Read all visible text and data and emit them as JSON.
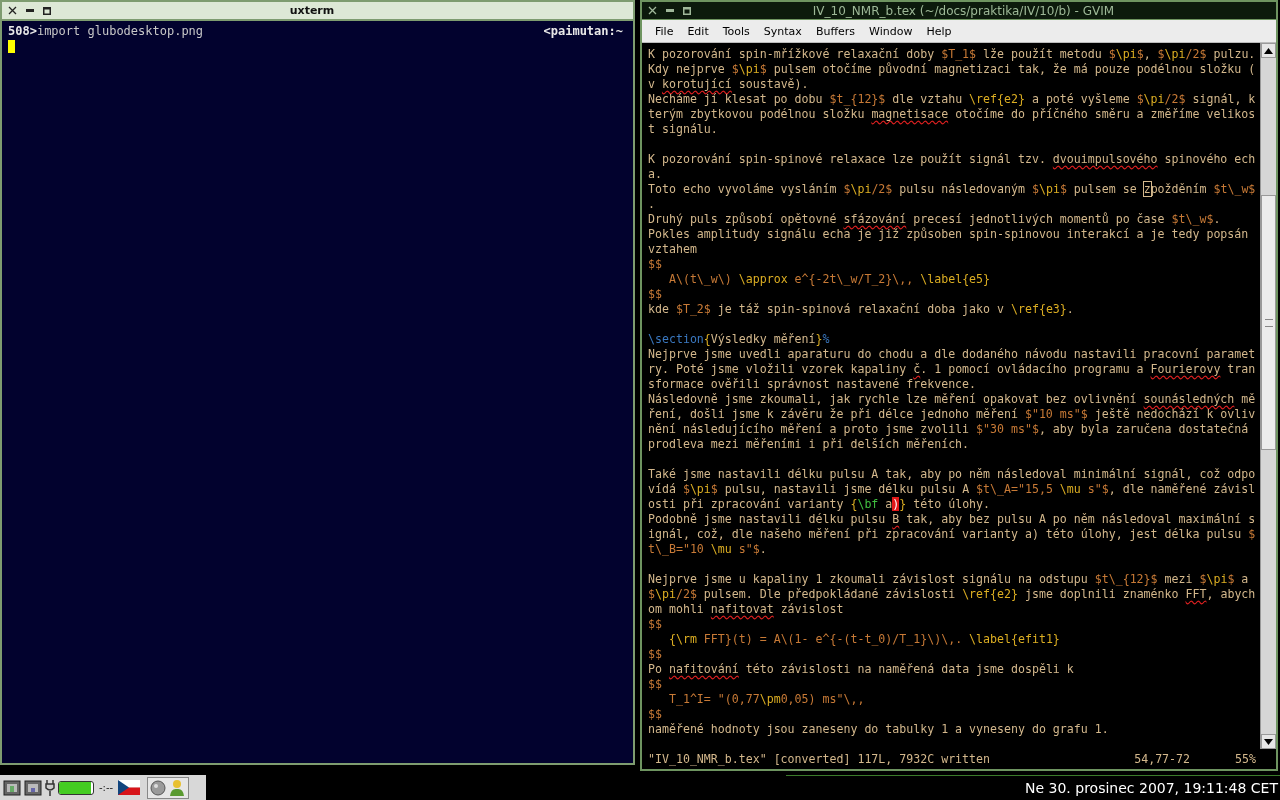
{
  "terminal": {
    "title": "uxterm",
    "prompt": "508>",
    "command": "import glubodesktop.png",
    "host": "<paimutan:~"
  },
  "editor": {
    "title": "IV_10_NMR_b.tex (~/docs/praktika/IV/10/b) - GVIM",
    "menu": [
      "File",
      "Edit",
      "Tools",
      "Syntax",
      "Buffers",
      "Window",
      "Help"
    ],
    "lines": [
      {
        "kind": "line",
        "segments": [
          {
            "kind": "text",
            "text": "K pozorování spin-mřížkové relaxační doby "
          },
          {
            "kind": "math",
            "text": "$T_1$"
          },
          {
            "kind": "text",
            "text": " lže použít metodu "
          },
          {
            "kind": "math",
            "text": "$"
          },
          {
            "kind": "command",
            "text": "\\pi"
          },
          {
            "kind": "math",
            "text": "$"
          },
          {
            "kind": "text",
            "text": ", "
          },
          {
            "kind": "math",
            "text": "$"
          },
          {
            "kind": "command",
            "text": "\\pi"
          },
          {
            "kind": "math",
            "text": "/2$"
          },
          {
            "kind": "text",
            "text": " pulzu."
          }
        ]
      },
      {
        "kind": "line",
        "segments": [
          {
            "kind": "text",
            "text": "Kdy nejprve "
          },
          {
            "kind": "math",
            "text": "$"
          },
          {
            "kind": "command",
            "text": "\\pi"
          },
          {
            "kind": "math",
            "text": "$"
          },
          {
            "kind": "text",
            "text": " pulsem otočíme původní magnetizaci tak, že má pouze podélnou složku ("
          }
        ]
      },
      {
        "kind": "line",
        "segments": [
          {
            "kind": "text",
            "text": "v "
          },
          {
            "kind": "spell",
            "text": "korotující"
          },
          {
            "kind": "text",
            "text": " soustavě)."
          }
        ]
      },
      {
        "kind": "line",
        "segments": [
          {
            "kind": "text",
            "text": "Necháme jí klesat po dobu "
          },
          {
            "kind": "math",
            "text": "$t_{12}$"
          },
          {
            "kind": "text",
            "text": " dle vztahu "
          },
          {
            "kind": "command",
            "text": "\\ref{e2}"
          },
          {
            "kind": "text",
            "text": " a poté vyšleme "
          },
          {
            "kind": "math",
            "text": "$"
          },
          {
            "kind": "command",
            "text": "\\pi"
          },
          {
            "kind": "math",
            "text": "/2$"
          },
          {
            "kind": "text",
            "text": " signál, k"
          }
        ]
      },
      {
        "kind": "line",
        "segments": [
          {
            "kind": "text",
            "text": "terým zbytkovou podélnou složku "
          },
          {
            "kind": "spell",
            "text": "magnetisace"
          },
          {
            "kind": "text",
            "text": " otočíme do příčného směru a změříme velikos"
          }
        ]
      },
      {
        "kind": "line",
        "segments": [
          {
            "kind": "text",
            "text": "t signálu."
          }
        ]
      },
      {
        "kind": "blank"
      },
      {
        "kind": "line",
        "segments": [
          {
            "kind": "text",
            "text": "K pozorování spin-spinové relaxace lze použít signál tzv. "
          },
          {
            "kind": "spell",
            "text": "dvouimpulsového"
          },
          {
            "kind": "text",
            "text": " spinového ech"
          }
        ]
      },
      {
        "kind": "line",
        "segments": [
          {
            "kind": "text",
            "text": "a."
          }
        ]
      },
      {
        "kind": "line",
        "segments": [
          {
            "kind": "text",
            "text": "Toto echo vyvoláme vysláním "
          },
          {
            "kind": "math",
            "text": "$"
          },
          {
            "kind": "command",
            "text": "\\pi"
          },
          {
            "kind": "math",
            "text": "/2$"
          },
          {
            "kind": "text",
            "text": " pulsu následovaným "
          },
          {
            "kind": "math",
            "text": "$"
          },
          {
            "kind": "command",
            "text": "\\pi"
          },
          {
            "kind": "math",
            "text": "$"
          },
          {
            "kind": "text",
            "text": " pulsem se "
          },
          {
            "kind": "cursor",
            "text": "z"
          },
          {
            "kind": "text",
            "text": "požděním "
          },
          {
            "kind": "math",
            "text": "$t\\_w$"
          }
        ]
      },
      {
        "kind": "line",
        "segments": [
          {
            "kind": "text",
            "text": "."
          }
        ]
      },
      {
        "kind": "line",
        "segments": [
          {
            "kind": "text",
            "text": "Druhý puls způsobí opětovné "
          },
          {
            "kind": "spell",
            "text": "sfázování"
          },
          {
            "kind": "text",
            "text": " precesí jednotlivých momentů po čase "
          },
          {
            "kind": "math",
            "text": "$t\\_w$"
          },
          {
            "kind": "text",
            "text": "."
          }
        ]
      },
      {
        "kind": "line",
        "segments": [
          {
            "kind": "text",
            "text": "Pokles amplitudy signálu echa je již způsoben spin-spinovou interakcí a je tedy popsán"
          }
        ]
      },
      {
        "kind": "line",
        "segments": [
          {
            "kind": "text",
            "text": "vztahem"
          }
        ]
      },
      {
        "kind": "line",
        "segments": [
          {
            "kind": "math",
            "text": "$$"
          }
        ]
      },
      {
        "kind": "line",
        "segments": [
          {
            "kind": "math",
            "text": "   A\\(t\\_w\\) "
          },
          {
            "kind": "command",
            "text": "\\approx"
          },
          {
            "kind": "math",
            "text": " e^{-2t\\_w/T_2}\\,, "
          },
          {
            "kind": "command",
            "text": "\\label{e5}"
          }
        ]
      },
      {
        "kind": "line",
        "segments": [
          {
            "kind": "math",
            "text": "$$"
          }
        ]
      },
      {
        "kind": "line",
        "segments": [
          {
            "kind": "text",
            "text": "kde "
          },
          {
            "kind": "math",
            "text": "$T_2$"
          },
          {
            "kind": "text",
            "text": " je táž spin-spinová relaxační doba jako v "
          },
          {
            "kind": "command",
            "text": "\\ref{e3}"
          },
          {
            "kind": "text",
            "text": "."
          }
        ]
      },
      {
        "kind": "blank"
      },
      {
        "kind": "line",
        "segments": [
          {
            "kind": "section",
            "text": "\\section"
          },
          {
            "kind": "command",
            "text": "{"
          },
          {
            "kind": "text",
            "text": "Výsledky měření"
          },
          {
            "kind": "command",
            "text": "}"
          },
          {
            "kind": "section",
            "text": "%"
          }
        ]
      },
      {
        "kind": "line",
        "segments": [
          {
            "kind": "text",
            "text": "Nejprve jsme uvedli aparaturu do chodu a dle dodaného návodu nastavili pracovní paramet"
          }
        ]
      },
      {
        "kind": "line",
        "segments": [
          {
            "kind": "text",
            "text": "ry. Poté jsme vložili vzorek kapaliny "
          },
          {
            "kind": "spell",
            "text": "č"
          },
          {
            "kind": "text",
            "text": ". 1 pomocí ovládacího programu a "
          },
          {
            "kind": "spell",
            "text": "Fourierovy"
          },
          {
            "kind": "text",
            "text": " tran"
          }
        ]
      },
      {
        "kind": "line",
        "segments": [
          {
            "kind": "text",
            "text": "sformace ověřili správnost nastavené frekvence."
          }
        ]
      },
      {
        "kind": "line",
        "segments": [
          {
            "kind": "text",
            "text": "Následovně jsme zkoumali, jak rychle lze měření opakovat bez ovlivnění "
          },
          {
            "kind": "spell",
            "text": "sounásledných"
          },
          {
            "kind": "text",
            "text": " mě"
          }
        ]
      },
      {
        "kind": "line",
        "segments": [
          {
            "kind": "text",
            "text": "ření, došli jsme k závěru že při délce jednoho měření "
          },
          {
            "kind": "math",
            "text": "$\"10 ms\"$"
          },
          {
            "kind": "text",
            "text": " ještě nedochází k ovliv"
          }
        ]
      },
      {
        "kind": "line",
        "segments": [
          {
            "kind": "text",
            "text": "nění následujícího měření a proto jsme zvolili "
          },
          {
            "kind": "math",
            "text": "$\"30 ms\"$"
          },
          {
            "kind": "text",
            "text": ", aby byla zaručena dostatečná"
          }
        ]
      },
      {
        "kind": "line",
        "segments": [
          {
            "kind": "text",
            "text": "prodleva mezi měřeními i při delších měřeních."
          }
        ]
      },
      {
        "kind": "blank"
      },
      {
        "kind": "line",
        "segments": [
          {
            "kind": "text",
            "text": "Také jsme nastavili délku pulsu A tak, aby po něm následoval minimální signál, což odpo"
          }
        ]
      },
      {
        "kind": "line",
        "segments": [
          {
            "kind": "text",
            "text": "vídá "
          },
          {
            "kind": "math",
            "text": "$"
          },
          {
            "kind": "command",
            "text": "\\pi"
          },
          {
            "kind": "math",
            "text": "$"
          },
          {
            "kind": "text",
            "text": " pulsu, nastavili jsme délku pulsu A "
          },
          {
            "kind": "math",
            "text": "$t\\_A=\"15,5 "
          },
          {
            "kind": "command",
            "text": "\\mu"
          },
          {
            "kind": "math",
            "text": " s\"$"
          },
          {
            "kind": "text",
            "text": ", dle naměřené závisl"
          }
        ]
      },
      {
        "kind": "line",
        "segments": [
          {
            "kind": "text",
            "text": "osti při zpracování varianty "
          },
          {
            "kind": "command",
            "text": "{"
          },
          {
            "kind": "bold",
            "text": "\\bf"
          },
          {
            "kind": "text",
            "text": " a"
          },
          {
            "kind": "error",
            "text": ")"
          },
          {
            "kind": "command",
            "text": "}"
          },
          {
            "kind": "text",
            "text": " této úlohy."
          }
        ]
      },
      {
        "kind": "line",
        "segments": [
          {
            "kind": "text",
            "text": "Podobně jsme nastavili délku pulsu "
          },
          {
            "kind": "spell",
            "text": "B"
          },
          {
            "kind": "text",
            "text": " tak, aby bez pulsu A po něm následoval maximální s"
          }
        ]
      },
      {
        "kind": "line",
        "segments": [
          {
            "kind": "text",
            "text": "ignál, což, dle našeho měření při zpracování varianty a) této úlohy, jest délka pulsu "
          },
          {
            "kind": "math",
            "text": "$"
          }
        ]
      },
      {
        "kind": "line",
        "segments": [
          {
            "kind": "math",
            "text": "t\\_B=\"10 "
          },
          {
            "kind": "command",
            "text": "\\mu"
          },
          {
            "kind": "math",
            "text": " s\"$"
          },
          {
            "kind": "text",
            "text": "."
          }
        ]
      },
      {
        "kind": "blank"
      },
      {
        "kind": "line",
        "segments": [
          {
            "kind": "text",
            "text": "Nejprve jsme u kapaliny 1 zkoumali závislost signálu na odstupu "
          },
          {
            "kind": "math",
            "text": "$t\\_{12}$"
          },
          {
            "kind": "text",
            "text": " mezi "
          },
          {
            "kind": "math",
            "text": "$"
          },
          {
            "kind": "command",
            "text": "\\pi"
          },
          {
            "kind": "math",
            "text": "$"
          },
          {
            "kind": "text",
            "text": " a"
          }
        ]
      },
      {
        "kind": "line",
        "segments": [
          {
            "kind": "math",
            "text": "$"
          },
          {
            "kind": "command",
            "text": "\\pi"
          },
          {
            "kind": "math",
            "text": "/2$"
          },
          {
            "kind": "text",
            "text": " pulsem. Dle předpokládané závislosti "
          },
          {
            "kind": "command",
            "text": "\\ref{e2}"
          },
          {
            "kind": "text",
            "text": " jsme doplnili znaménko "
          },
          {
            "kind": "spell",
            "text": "FFT"
          },
          {
            "kind": "text",
            "text": ", abych"
          }
        ]
      },
      {
        "kind": "line",
        "segments": [
          {
            "kind": "text",
            "text": "om mohli "
          },
          {
            "kind": "spell",
            "text": "nafitovat"
          },
          {
            "kind": "text",
            "text": " závislost"
          }
        ]
      },
      {
        "kind": "line",
        "segments": [
          {
            "kind": "math",
            "text": "$$"
          }
        ]
      },
      {
        "kind": "line",
        "segments": [
          {
            "kind": "command",
            "text": "   {\\rm"
          },
          {
            "kind": "math",
            "text": " FFT}(t) = A\\(1- e^{-(t-t_0)/T_1}\\)\\,. "
          },
          {
            "kind": "command",
            "text": "\\label{efit1}"
          }
        ]
      },
      {
        "kind": "line",
        "segments": [
          {
            "kind": "math",
            "text": "$$"
          }
        ]
      },
      {
        "kind": "line",
        "segments": [
          {
            "kind": "text",
            "text": "Po "
          },
          {
            "kind": "spell",
            "text": "nafitování"
          },
          {
            "kind": "text",
            "text": " této závislosti na naměřená data jsme dospěli k"
          }
        ]
      },
      {
        "kind": "line",
        "segments": [
          {
            "kind": "math",
            "text": "$$"
          }
        ]
      },
      {
        "kind": "line",
        "segments": [
          {
            "kind": "math",
            "text": "   T_1^I= \"(0,77"
          },
          {
            "kind": "command",
            "text": "\\pm"
          },
          {
            "kind": "math",
            "text": "0,05) ms\"\\,,"
          }
        ]
      },
      {
        "kind": "line",
        "segments": [
          {
            "kind": "math",
            "text": "$$"
          }
        ]
      },
      {
        "kind": "line",
        "segments": [
          {
            "kind": "text",
            "text": "naměřené hodnoty jsou zaneseny do tabulky 1 a vyneseny do grafu 1."
          }
        ]
      }
    ],
    "status": {
      "message": "\"IV_10_NMR_b.tex\" [converted] 117L, 7932C written",
      "position": "54,77-72",
      "percent": "55%"
    }
  },
  "taskbar": {
    "battery": {
      "level": 0.95
    },
    "battery_time": "-:--",
    "clock": "Ne 30. prosinec 2007, 19:11:48 CET"
  }
}
